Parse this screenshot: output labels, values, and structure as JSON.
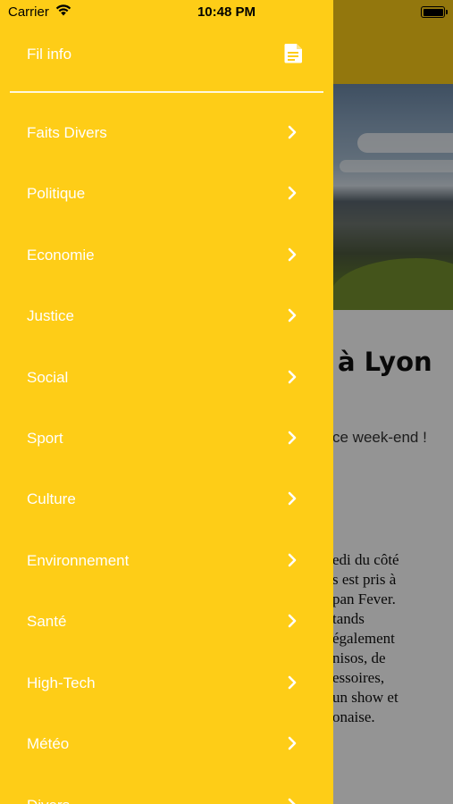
{
  "status_bar": {
    "carrier": "Carrier",
    "time": "10:48 PM"
  },
  "background_article": {
    "title_fragment": "à Lyon",
    "subtitle_fragment": "ce week-end !",
    "body_lines": [
      "edi du côté",
      "s est pris à",
      "pan Fever.",
      "tands",
      "également",
      "nisos, de",
      "essoires,",
      "un show et",
      "onaise."
    ]
  },
  "drawer": {
    "title": "Fil info",
    "title_icon": "document-icon",
    "background_color": "#fecd17",
    "items": [
      {
        "label": "Faits Divers"
      },
      {
        "label": "Politique"
      },
      {
        "label": "Economie"
      },
      {
        "label": "Justice"
      },
      {
        "label": "Social"
      },
      {
        "label": "Sport"
      },
      {
        "label": "Culture"
      },
      {
        "label": "Environnement"
      },
      {
        "label": "Santé"
      },
      {
        "label": "High-Tech"
      },
      {
        "label": "Météo"
      },
      {
        "label": "Divers"
      }
    ]
  }
}
